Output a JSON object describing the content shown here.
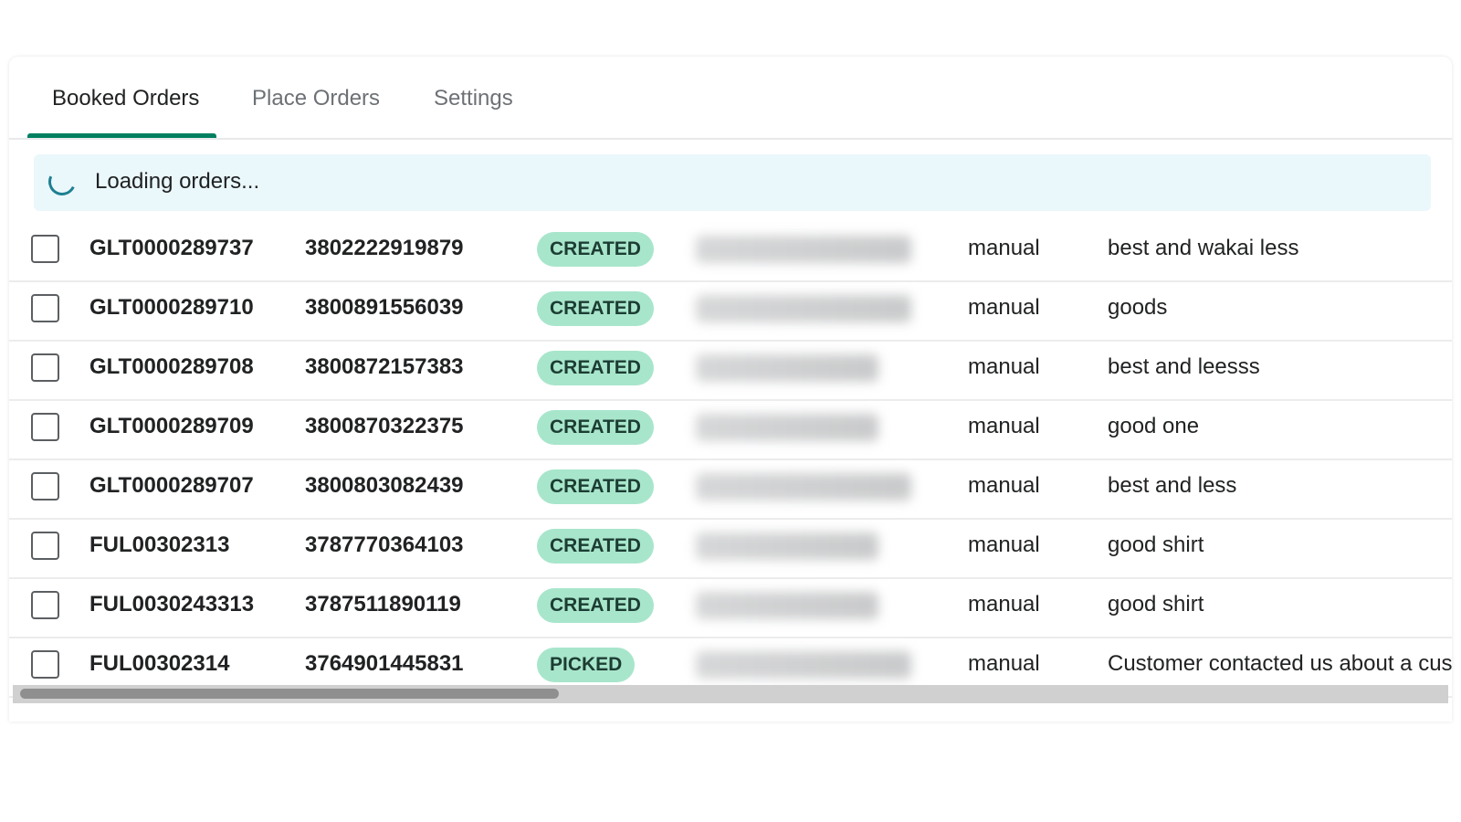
{
  "tabs": [
    {
      "label": "Booked Orders",
      "active": true
    },
    {
      "label": "Place Orders",
      "active": false
    },
    {
      "label": "Settings",
      "active": false
    }
  ],
  "banner": {
    "text": "Loading orders..."
  },
  "status_colors": {
    "CREATED": "#a8e6cc",
    "PICKED": "#a8e6cc"
  },
  "accent": "#008060",
  "orders": [
    {
      "order_id": "GLT0000289737",
      "tracking": "3802222919879",
      "status": "CREATED",
      "source": "manual",
      "note": "best and wakai less"
    },
    {
      "order_id": "GLT0000289710",
      "tracking": "3800891556039",
      "status": "CREATED",
      "source": "manual",
      "note": "goods"
    },
    {
      "order_id": "GLT0000289708",
      "tracking": "3800872157383",
      "status": "CREATED",
      "source": "manual",
      "note": "best and leesss"
    },
    {
      "order_id": "GLT0000289709",
      "tracking": "3800870322375",
      "status": "CREATED",
      "source": "manual",
      "note": "good one"
    },
    {
      "order_id": "GLT0000289707",
      "tracking": "3800803082439",
      "status": "CREATED",
      "source": "manual",
      "note": "best and less"
    },
    {
      "order_id": "FUL00302313",
      "tracking": "3787770364103",
      "status": "CREATED",
      "source": "manual",
      "note": "good shirt"
    },
    {
      "order_id": "FUL0030243313",
      "tracking": "3787511890119",
      "status": "CREATED",
      "source": "manual",
      "note": "good shirt"
    },
    {
      "order_id": "FUL00302314",
      "tracking": "3764901445831",
      "status": "PICKED",
      "source": "manual",
      "note": "Customer contacted us about a custo"
    }
  ]
}
